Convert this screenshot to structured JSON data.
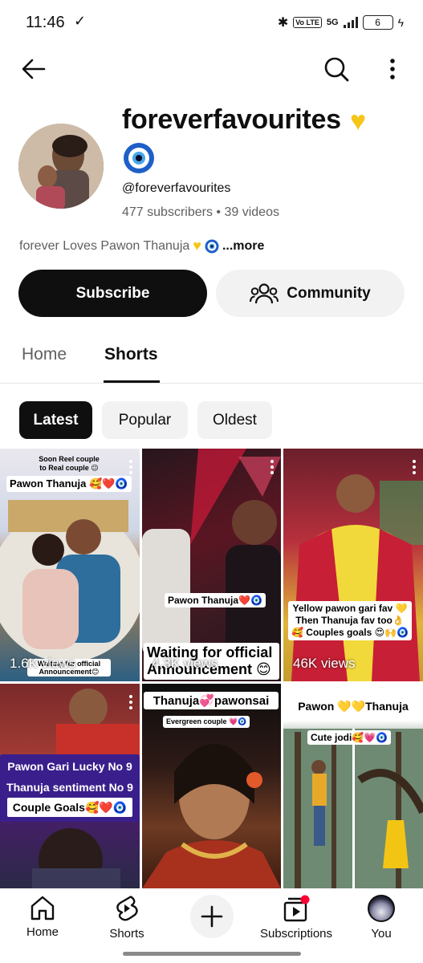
{
  "status_bar": {
    "time": "11:46",
    "network": "5G",
    "volte": "Vo LTE",
    "battery": "6"
  },
  "channel": {
    "name": "foreverfavourites",
    "handle": "@foreverfavourites",
    "subscribers": "477 subscribers",
    "separator": "•",
    "videos": "39 videos",
    "description": "forever Loves Pawon Thanuja",
    "more": "...more"
  },
  "actions": {
    "subscribe": "Subscribe",
    "community": "Community"
  },
  "tabs": {
    "home": "Home",
    "shorts": "Shorts"
  },
  "filters": {
    "latest": "Latest",
    "popular": "Popular",
    "oldest": "Oldest"
  },
  "shorts": [
    {
      "caption_small": "Soon Reel couple to Real couple 😉",
      "caption": "Pawon Thanuja 🥰❤️🧿",
      "caption_bottom": "Waiting for official Announcement😊",
      "views": "1.6K views"
    },
    {
      "caption": "Pawon Thanuja❤️🧿",
      "caption_bottom": "Waiting for official Announcement 😊",
      "views": "4.3K views"
    },
    {
      "caption": "Yellow pawon gari fav 💛 Then Thanuja fav too👌🥰 Couples goals 😍🙌🧿",
      "views": "46K views"
    },
    {
      "line1": "Pawon Gari Lucky No 9",
      "line2": "Thanuja sentiment No 9",
      "line3": "Couple Goals🥰❤️🧿"
    },
    {
      "caption": "Thanuja💞pawonsai",
      "caption_small": "Evergreen couple 💗🧿"
    },
    {
      "caption": "Pawon 💛💛Thanuja",
      "caption_small": "Cute jodi🥰💗🧿"
    }
  ],
  "nav": {
    "home": "Home",
    "shorts": "Shorts",
    "subscriptions": "Subscriptions",
    "you": "You"
  },
  "colors": {
    "accent": "#0f0f0f",
    "chip_bg": "#f2f2f2",
    "notification": "#ff0033",
    "secondary_text": "#606060"
  }
}
